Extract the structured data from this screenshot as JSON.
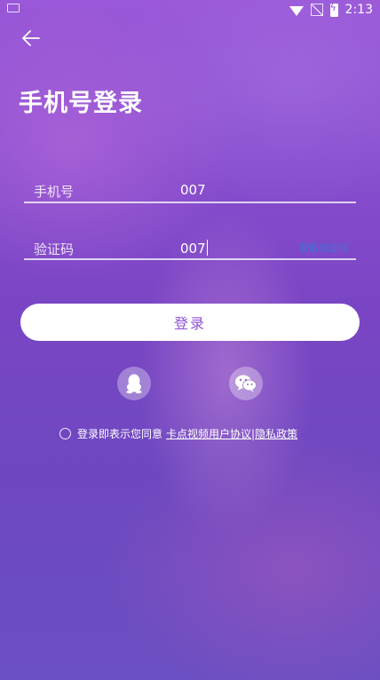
{
  "status_bar": {
    "time": "2:13"
  },
  "header": {
    "title": "手机号登录"
  },
  "form": {
    "phone": {
      "label": "手机号",
      "value": "007"
    },
    "code": {
      "label": "验证码",
      "value": "007",
      "get_code_label": "获取验证码"
    },
    "login_label": "登录"
  },
  "social": {
    "icons": [
      "qq-icon",
      "wechat-icon"
    ]
  },
  "agreement": {
    "prefix": "登录即表示您同意",
    "user_agreement": "卡点视频用户协议",
    "separator": "|",
    "privacy_policy": "隐私政策"
  },
  "colors": {
    "accent": "#8f52d6",
    "link_blue": "#3a76d8"
  }
}
